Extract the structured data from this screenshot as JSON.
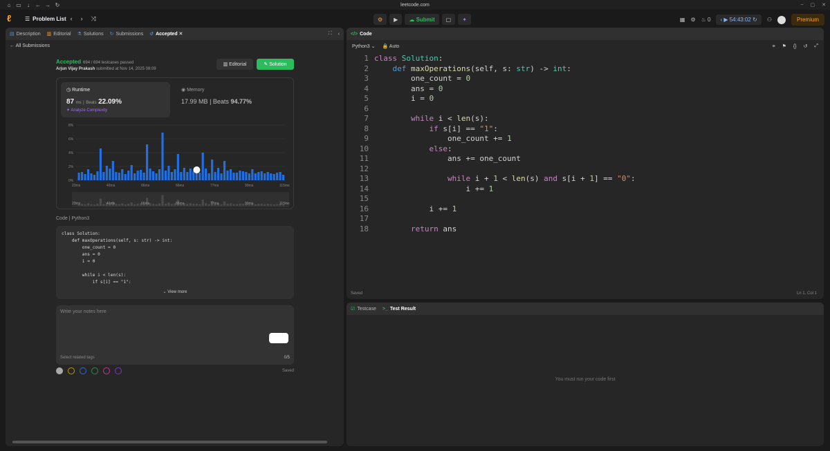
{
  "browser": {
    "url": "leetcode.com"
  },
  "nav": {
    "problem_list": "Problem List",
    "submit": "Submit",
    "timer": "54:43:02",
    "streak": "0",
    "premium": "Premium"
  },
  "tabs": [
    "Description",
    "Editorial",
    "Solutions",
    "Submissions",
    "Accepted"
  ],
  "left": {
    "back": "All Submissions",
    "status": "Accepted",
    "testcases": "694 / 694 testcases passed",
    "author": "Arjun Vijay Prakash",
    "submitted": "submitted at Nov 14, 2025 08:09",
    "editorial_btn": "Editorial",
    "solution_btn": "Solution",
    "runtime_label": "Runtime",
    "runtime_value": "87",
    "runtime_unit": "ms",
    "beats_label": "Beats",
    "runtime_beats": "22.09%",
    "analyze": "Analyze Complexity",
    "memory_label": "Memory",
    "memory_value": "17.99",
    "memory_unit": "MB",
    "memory_beats": "94.77%",
    "code_label": "Code",
    "lang": "Python3",
    "view_more": "View more",
    "notes_placeholder": "Write your notes here",
    "tags_placeholder": "Select related tags",
    "tag_count": "0/5",
    "saved": "Saved"
  },
  "chart_data": {
    "type": "bar",
    "yticks": [
      "8%",
      "6%",
      "4%",
      "2%",
      "0%"
    ],
    "xticks": [
      "23ms",
      "42ms",
      "66ms",
      "66ms",
      "77ms",
      "90ms",
      "115ms"
    ],
    "values": [
      1.1,
      1.2,
      0.9,
      1.6,
      1.0,
      0.8,
      1.3,
      4.6,
      1.2,
      2.1,
      1.7,
      2.8,
      1.2,
      1.1,
      1.6,
      0.9,
      1.4,
      2.2,
      1.0,
      1.4,
      1.5,
      1.1,
      5.2,
      1.7,
      1.3,
      1.0,
      1.6,
      6.9,
      1.4,
      2.1,
      1.2,
      1.6,
      3.8,
      1.2,
      1.8,
      1.2,
      1.7,
      1.3,
      1.3,
      1.1,
      4.0,
      1.7,
      1.0,
      3.0,
      1.2,
      1.8,
      1.0,
      2.8,
      1.4,
      1.6,
      1.1,
      1.1,
      1.4,
      1.3,
      1.2,
      1.0,
      1.6,
      1.0,
      1.2,
      1.3,
      1.0,
      1.2,
      1.0,
      0.9,
      1.1,
      1.2,
      0.8
    ],
    "highlight_index": 38,
    "ylim": [
      0,
      8
    ]
  },
  "code_preview": "class Solution:\n    def maxOperations(self, s: str) -> int:\n        one_count = 0\n        ans = 0\n        i = 0\n\n        while i < len(s):\n            if s[i] == \"1\":",
  "editor": {
    "title": "Code",
    "lang": "Python3",
    "auto": "Auto",
    "saved": "Saved",
    "cursor": "Ln 1, Col 1"
  },
  "bottom": {
    "testcase": "Testcase",
    "result": "Test Result",
    "message": "You must run your code first"
  }
}
